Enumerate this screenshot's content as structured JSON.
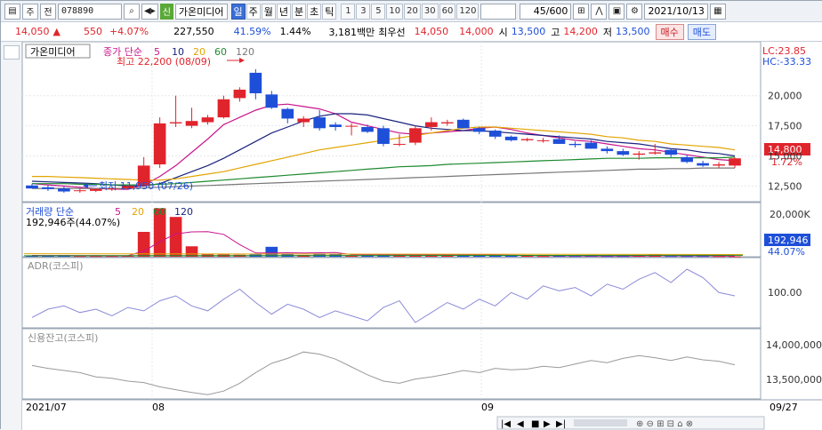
{
  "toolbar": {
    "market_select": "주",
    "prev_label": "전",
    "stock_code": "078890",
    "search_icon": "search-icon",
    "sound_icon": "speaker-icon",
    "new_badge": "신",
    "stock_name": "가온미디어",
    "period_tabs": [
      "일",
      "주",
      "월",
      "년",
      "분",
      "초",
      "틱"
    ],
    "active_period": "일",
    "interval_tabs": [
      "1",
      "3",
      "5",
      "10",
      "20",
      "30",
      "60",
      "120"
    ],
    "count_display": "45/600",
    "date_value": "2021/10/13"
  },
  "price_info": {
    "price": "14,050",
    "change_arrow": "▲",
    "change": "550",
    "change_rate": "+4.07%",
    "volume": "227,550",
    "volume_rate": "41.59%",
    "turnover": "1.44%",
    "amount": "3,181백만",
    "best_bid_label": "최우선",
    "best_bid": "14,050",
    "best_ask": "14,000",
    "open_label": "시",
    "open": "13,500",
    "high_label": "고",
    "high": "14,200",
    "low_label": "저",
    "low": "13,500",
    "buy_label": "매수",
    "sell_label": "매도"
  },
  "price_panel": {
    "title": "가온미디어",
    "legend_label": "종가 단순",
    "legend_periods": [
      "5",
      "10",
      "20",
      "60",
      "120"
    ],
    "legend_colors": [
      "#c8148c",
      "#1a237e",
      "#e2a400",
      "#1e8a2f",
      "#777777"
    ],
    "max_label": "최고 22,200 (08/09)",
    "min_label": "최저 11,950 (07/26)",
    "lc_label": "LC:23.85",
    "hc_label": "HC:-33.33",
    "current_price": "14,800",
    "current_rate": "1.72%",
    "axis_ticks": [
      "20,000",
      "17,500",
      "15,000",
      "12,500"
    ]
  },
  "volume_panel": {
    "legend_label": "거래량 단순",
    "legend_periods": [
      "5",
      "20",
      "60",
      "120"
    ],
    "legend_colors": [
      "#c8148c",
      "#e2a400",
      "#1e8a2f",
      "#1a237e"
    ],
    "max_label": "192,946주(44.07%)",
    "axis_top": "20,000K",
    "current_value": "192,946",
    "current_rate": "44.07%"
  },
  "adr_panel": {
    "title": "ADR(코스피)",
    "axis_value": "100.00"
  },
  "credit_panel": {
    "title": "신용잔고(코스피)",
    "axis_ticks": [
      "14,000,000",
      "13,500,000"
    ]
  },
  "x_axis": {
    "labels": [
      "2021/07",
      "08",
      "09"
    ],
    "last_label": "09/27"
  },
  "chart_data": [
    {
      "type": "candlestick",
      "title": "가온미디어",
      "ylim": [
        11500,
        23000
      ],
      "candles": [
        {
          "o": 12550,
          "h": 12700,
          "l": 12300,
          "c": 12300
        },
        {
          "o": 12400,
          "h": 12550,
          "l": 12100,
          "c": 12250
        },
        {
          "o": 12300,
          "h": 12450,
          "l": 11950,
          "c": 12050
        },
        {
          "o": 12150,
          "h": 12300,
          "l": 11950,
          "c": 12150
        },
        {
          "o": 12100,
          "h": 12300,
          "l": 12000,
          "c": 12250
        },
        {
          "o": 12250,
          "h": 12400,
          "l": 12100,
          "c": 12300
        },
        {
          "o": 12300,
          "h": 12600,
          "l": 12250,
          "c": 12500
        },
        {
          "o": 12500,
          "h": 14900,
          "l": 12500,
          "c": 14200
        },
        {
          "o": 14300,
          "h": 18200,
          "l": 14000,
          "c": 17700
        },
        {
          "o": 17700,
          "h": 20000,
          "l": 17400,
          "c": 17800
        },
        {
          "o": 17500,
          "h": 19000,
          "l": 17300,
          "c": 17900
        },
        {
          "o": 17800,
          "h": 18400,
          "l": 17600,
          "c": 18200
        },
        {
          "o": 18200,
          "h": 20000,
          "l": 18100,
          "c": 19700
        },
        {
          "o": 19800,
          "h": 20700,
          "l": 19500,
          "c": 20500
        },
        {
          "o": 21900,
          "h": 22200,
          "l": 19700,
          "c": 20200
        },
        {
          "o": 20100,
          "h": 20400,
          "l": 18900,
          "c": 19000
        },
        {
          "o": 18900,
          "h": 19000,
          "l": 17700,
          "c": 18100
        },
        {
          "o": 17800,
          "h": 18300,
          "l": 17400,
          "c": 18100
        },
        {
          "o": 18200,
          "h": 18800,
          "l": 17100,
          "c": 17300
        },
        {
          "o": 17600,
          "h": 17800,
          "l": 17100,
          "c": 17400
        },
        {
          "o": 17500,
          "h": 17700,
          "l": 16700,
          "c": 17500
        },
        {
          "o": 17400,
          "h": 17600,
          "l": 16900,
          "c": 17000
        },
        {
          "o": 17300,
          "h": 17500,
          "l": 15800,
          "c": 16000
        },
        {
          "o": 16000,
          "h": 16800,
          "l": 15800,
          "c": 16000
        },
        {
          "o": 16100,
          "h": 17500,
          "l": 15900,
          "c": 17300
        },
        {
          "o": 17400,
          "h": 18200,
          "l": 17100,
          "c": 17800
        },
        {
          "o": 17700,
          "h": 18000,
          "l": 17500,
          "c": 17800
        },
        {
          "o": 18000,
          "h": 18100,
          "l": 17300,
          "c": 17300
        },
        {
          "o": 17300,
          "h": 17400,
          "l": 16800,
          "c": 17000
        },
        {
          "o": 17100,
          "h": 17200,
          "l": 16400,
          "c": 16600
        },
        {
          "o": 16600,
          "h": 16700,
          "l": 16200,
          "c": 16300
        },
        {
          "o": 16300,
          "h": 16500,
          "l": 16200,
          "c": 16400
        },
        {
          "o": 16300,
          "h": 16500,
          "l": 16100,
          "c": 16300
        },
        {
          "o": 16400,
          "h": 16700,
          "l": 16000,
          "c": 16000
        },
        {
          "o": 16000,
          "h": 16200,
          "l": 15700,
          "c": 15900
        },
        {
          "o": 16100,
          "h": 16300,
          "l": 15600,
          "c": 15600
        },
        {
          "o": 15600,
          "h": 15800,
          "l": 15200,
          "c": 15400
        },
        {
          "o": 15400,
          "h": 15600,
          "l": 15000,
          "c": 15100
        },
        {
          "o": 15100,
          "h": 15400,
          "l": 14700,
          "c": 15200
        },
        {
          "o": 15200,
          "h": 16000,
          "l": 15100,
          "c": 15300
        },
        {
          "o": 15500,
          "h": 15600,
          "l": 14900,
          "c": 15100
        },
        {
          "o": 14900,
          "h": 15100,
          "l": 14400,
          "c": 14500
        },
        {
          "o": 14400,
          "h": 14600,
          "l": 14100,
          "c": 14200
        },
        {
          "o": 14200,
          "h": 14500,
          "l": 14000,
          "c": 14300
        },
        {
          "o": 14200,
          "h": 14900,
          "l": 14000,
          "c": 14800
        }
      ],
      "ma": [
        {
          "name": "5",
          "values": [
            12700,
            12600,
            12500,
            12400,
            12300,
            12250,
            12220,
            12600,
            13300,
            14200,
            15300,
            16400,
            17600,
            18200,
            18800,
            19200,
            19300,
            19100,
            18900,
            18500,
            17800,
            17500,
            17200,
            16900,
            16800,
            16900,
            17000,
            17100,
            17300,
            17400,
            17200,
            16900,
            16700,
            16500,
            16300,
            16200,
            16000,
            15800,
            15600,
            15500,
            15300,
            15100,
            14900,
            14700,
            14600
          ]
        },
        {
          "name": "10",
          "values": [
            12900,
            12850,
            12800,
            12750,
            12700,
            12600,
            12500,
            12500,
            12700,
            13200,
            13700,
            14200,
            14800,
            15500,
            16200,
            16900,
            17400,
            17900,
            18300,
            18500,
            18500,
            18400,
            18100,
            17800,
            17500,
            17300,
            17200,
            17100,
            17100,
            17000,
            16900,
            16800,
            16700,
            16600,
            16500,
            16400,
            16200,
            16100,
            16000,
            15800,
            15600,
            15500,
            15300,
            15200,
            15000
          ]
        },
        {
          "name": "20",
          "values": [
            13300,
            13300,
            13250,
            13200,
            13150,
            13100,
            13050,
            13000,
            13000,
            13100,
            13300,
            13500,
            13700,
            14000,
            14300,
            14600,
            14900,
            15200,
            15500,
            15700,
            15900,
            16100,
            16300,
            16500,
            16700,
            16900,
            17100,
            17300,
            17400,
            17400,
            17300,
            17200,
            17100,
            17000,
            16900,
            16800,
            16600,
            16500,
            16300,
            16200,
            16000,
            15900,
            15800,
            15700,
            15500
          ]
        },
        {
          "name": "60",
          "values": [
            12700,
            12700,
            12700,
            12650,
            12650,
            12600,
            12600,
            12600,
            12650,
            12700,
            12800,
            12900,
            13000,
            13100,
            13200,
            13300,
            13400,
            13500,
            13600,
            13700,
            13800,
            13900,
            14000,
            14100,
            14150,
            14200,
            14300,
            14350,
            14400,
            14450,
            14500,
            14550,
            14600,
            14650,
            14700,
            14750,
            14800,
            14800,
            14800,
            14850,
            14850,
            14850,
            14850,
            14850,
            14900
          ]
        },
        {
          "name": "120",
          "values": [
            12300,
            12300,
            12300,
            12300,
            12300,
            12300,
            12300,
            12350,
            12400,
            12450,
            12500,
            12550,
            12600,
            12650,
            12700,
            12750,
            12800,
            12850,
            12900,
            12950,
            13000,
            13050,
            13100,
            13150,
            13200,
            13250,
            13300,
            13350,
            13400,
            13450,
            13500,
            13550,
            13600,
            13650,
            13700,
            13750,
            13800,
            13850,
            13900,
            13900,
            13950,
            13950,
            14000,
            14000,
            14000
          ]
        }
      ]
    },
    {
      "type": "bar",
      "title": "거래량",
      "ylim": [
        0,
        20000
      ],
      "values": [
        500,
        400,
        600,
        300,
        300,
        300,
        400,
        10000,
        19500,
        16000,
        4200,
        1000,
        900,
        800,
        900,
        4000,
        1200,
        700,
        1300,
        900,
        600,
        900,
        900,
        800,
        600,
        700,
        900,
        800,
        600,
        500,
        400,
        400,
        300,
        400,
        300,
        400,
        300,
        300,
        400,
        900,
        300,
        300,
        300,
        250,
        193
      ],
      "ma5": [
        550,
        500,
        500,
        450,
        420,
        380,
        380,
        2300,
        6000,
        9200,
        10000,
        10100,
        9000,
        4900,
        1500,
        1500,
        1600,
        1500,
        1600,
        1700,
        900,
        850,
        900,
        850,
        800,
        800,
        800,
        800,
        780,
        700,
        620,
        550,
        480,
        440,
        380,
        360,
        340,
        340,
        340,
        440,
        420,
        400,
        400,
        410,
        290
      ]
    },
    {
      "type": "line",
      "title": "ADR(코스피)",
      "values": [
        98.5,
        99.0,
        99.2,
        98.8,
        99.0,
        98.6,
        99.1,
        98.9,
        99.5,
        99.8,
        99.2,
        98.9,
        99.6,
        100.2,
        99.4,
        98.7,
        99.3,
        99.0,
        98.5,
        98.9,
        98.6,
        98.3,
        99.1,
        99.5,
        98.2,
        98.8,
        99.4,
        99.0,
        99.6,
        99.2,
        100.0,
        99.6,
        100.4,
        100.1,
        100.3,
        99.8,
        100.5,
        100.2,
        100.8,
        101.2,
        100.6,
        101.4,
        100.9,
        100.0,
        99.8
      ]
    },
    {
      "type": "line",
      "title": "신용잔고(코스피)",
      "values": [
        13720,
        13680,
        13650,
        13620,
        13560,
        13540,
        13500,
        13480,
        13420,
        13380,
        13340,
        13310,
        13360,
        13470,
        13620,
        13750,
        13820,
        13910,
        13880,
        13810,
        13700,
        13590,
        13500,
        13470,
        13530,
        13560,
        13600,
        13650,
        13620,
        13680,
        13660,
        13670,
        13710,
        13690,
        13740,
        13790,
        13760,
        13820,
        13860,
        13830,
        13790,
        13840,
        13800,
        13780,
        13730
      ]
    }
  ]
}
